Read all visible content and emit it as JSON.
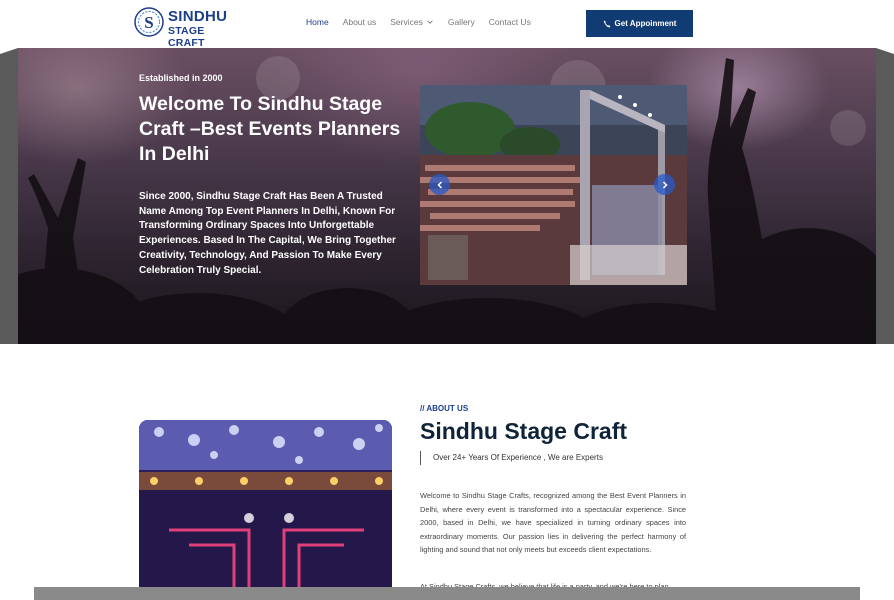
{
  "brand": {
    "line1": "SINDHU",
    "line2": "STAGE CRAFT",
    "badge_letter": "S"
  },
  "nav": {
    "items": [
      {
        "label": "Home",
        "active": true
      },
      {
        "label": "About us"
      },
      {
        "label": "Services",
        "has_dropdown": true
      },
      {
        "label": "Gallery"
      },
      {
        "label": "Contact Us"
      }
    ]
  },
  "cta": {
    "label": "Get Appoinment",
    "icon": "phone-icon"
  },
  "hero": {
    "sub": "Established in 2000",
    "title": "Welcome To Sindhu Stage Craft –Best Events Planners In Delhi",
    "desc": "Since 2000, Sindhu Stage Craft Has Been A Trusted Name Among Top Event Planners In Delhi, Known For Transforming Ordinary Spaces Into Unforgettable Experiences. Based In The Capital, We Bring Together Creativity, Technology, And Passion To Make Every Celebration Truly Special."
  },
  "about": {
    "tag": "// ABOUT US",
    "title": "Sindhu Stage Craft",
    "sub": "Over 24+ Years Of Experience , We are Experts",
    "p1": "Welcome to Sindhu Stage Crafts, recognized among the Best Event Planners in Delhi, where every event is transformed into a spectacular experience. Since 2000, based in Delhi, we have specialized in turning ordinary spaces into extraordinary moments. Our passion lies in delivering the perfect harmony of lighting and sound that not only meets but exceeds client expectations.",
    "p2": "At Sindhu Stage Crafts, we believe that life is a party, and we're here to plan"
  },
  "colors": {
    "brand": "#1c3f8a",
    "cta": "#113b73",
    "arrow": "#285ac8"
  }
}
